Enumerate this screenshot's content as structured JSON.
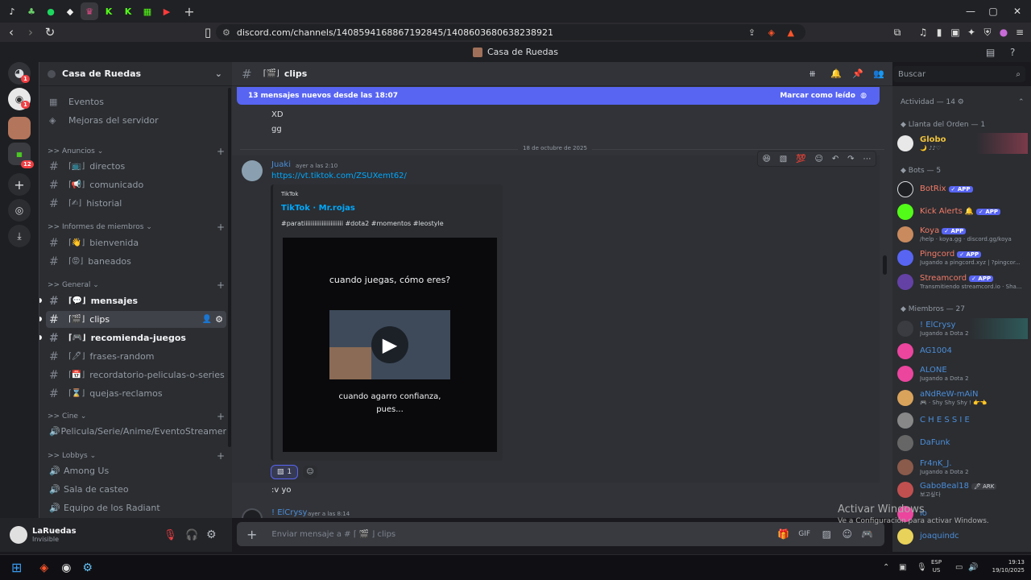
{
  "browser": {
    "tabs": [
      "tiktok",
      "leaf",
      "spotify",
      "shape",
      "discord",
      "kick",
      "kick2",
      "grid",
      "youtube"
    ],
    "url": "discord.com/channels/1408594168867192845/1408603680638238921"
  },
  "discord": {
    "window_title": "Casa de Ruedas",
    "server_name": "Casa de Ruedas",
    "rail_badges": [
      "1",
      "1",
      "12"
    ],
    "top_items": [
      "Eventos",
      "Mejoras del servidor"
    ],
    "categories": [
      ">> Anuncios",
      ">> Informes de miembros",
      ">> General",
      ">> Cine",
      ">> Lobbys"
    ],
    "channels": {
      "directos": "directos",
      "comunicado": "comunicado",
      "historial": "historial",
      "bienvenida": "bienvenida",
      "baneados": "baneados",
      "mensajes": "mensajes",
      "clips": "clips",
      "recomienda": "recomienda-juegos",
      "frases": "frases-random",
      "recordatorio": "recordatorio-peliculas-o-series",
      "quejas": "quejas-reclamos",
      "cine": "Pelicula/Serie/Anime/EventoStreamer",
      "among": "Among Us",
      "sala": "Sala de casteo",
      "equipo": "Equipo de los Radiant"
    },
    "user": {
      "name": "LaRuedas",
      "status": "Invisible"
    },
    "header": {
      "channel": "clips",
      "search_placeholder": "Buscar"
    },
    "new_bar": {
      "text": "13 mensajes nuevos desde las 18:07",
      "action": "Marcar como leído"
    },
    "messages": {
      "prev1": "XD",
      "prev2": "gg",
      "date_divider": "18 de octubre de 2025",
      "author": "Juaki",
      "time": "ayer a las 2:10",
      "link": "https://vt.tiktok.com/ZSUXemt62/",
      "embed_provider": "TikTok",
      "embed_title": "TikTok · Mr.rojas",
      "embed_desc": "#paratiiiiiiiiiiiiiiiiiiiiii #dota2 #momentos #leostyle",
      "video_top": "cuando juegas, cómo eres?",
      "video_bottom1": "cuando agarro confianza,",
      "video_bottom2": "pues...",
      "reaction_count": "1",
      "reply": ":v yo",
      "next_author": "! ElCrysy",
      "next_time": "ayer a las 8:14"
    },
    "composer_placeholder": "Enviar mensaje a #  ⌈ 🎬 ⌋  clips",
    "members": {
      "activity": "Actividad — 14",
      "group_orden": "Llanta del Orden — 1",
      "group_bots": "Bots — 5",
      "group_members": "Miembros — 27",
      "app_tag": "APP",
      "ark_tag": "ARK",
      "globo": "Globo",
      "globo_sub": "🌙 ♪♪♡",
      "botrix": "BotRix",
      "kick": "Kick Alerts",
      "koya": "Koya",
      "koya_sub": "/help · koya.gg · discord.gg/koya",
      "pingcord": "Pingcord",
      "pingcord_sub": "Jugando a pingcord.xyz | ?pingcor...",
      "streamcord": "Streamcord",
      "streamcord_sub": "Transmitiendo streamcord.io · Sha...",
      "elcrysy": "! ElCrysy",
      "playing_dota": "Jugando a Dota 2",
      "ag": "AG1004",
      "alone": "ALONE",
      "andrew": "aNdReW-mAiN",
      "andrew_sub": "🎮 · Shy Shy Shy ! 👉👈",
      "chessie": "C H E S S I E",
      "dafunk": "DaFunk",
      "fr4nk": "Fr4nK_J.",
      "gabo": "GaboBeal18",
      "gabo_sub": "보고싶다",
      "io": "io",
      "joaq": "joaquindc"
    },
    "watermark1": "Activar Windows",
    "watermark2": "Ve a Configuración para activar Windows."
  },
  "taskbar": {
    "lang": "ESP",
    "region": "US",
    "time": "19:13",
    "date": "19/10/2025"
  },
  "colors": {
    "blurple": "#5865f2",
    "bg": "#313338",
    "sidebar": "#2b2d31",
    "link": "#00a8fc"
  }
}
